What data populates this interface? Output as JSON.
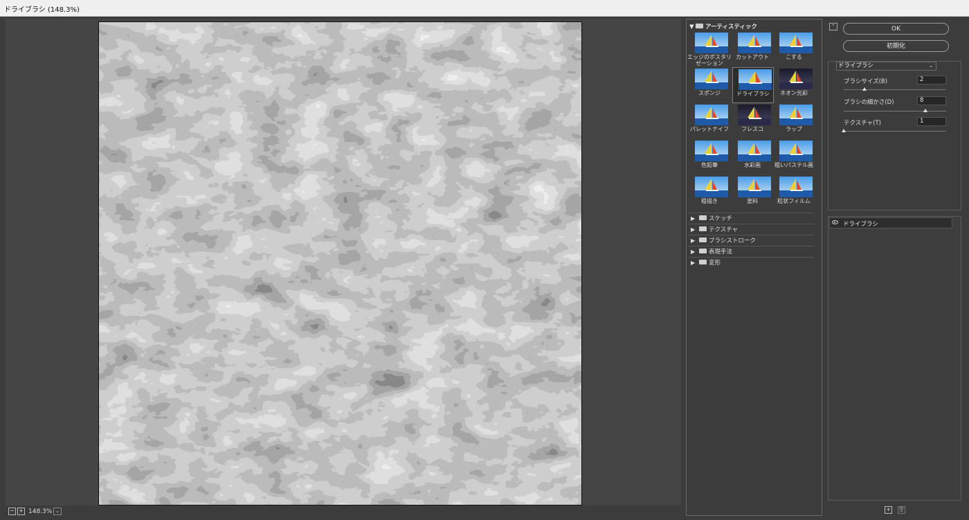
{
  "window": {
    "title": "ドライブラシ (148.3%)"
  },
  "preview": {
    "zoom": "148.3%",
    "zoom_out": "−",
    "zoom_in": "+",
    "zoom_menu": "⌄"
  },
  "gallery": {
    "category_open": "アーティスティック",
    "filters": [
      {
        "label": "エッジのポスタリゼーション",
        "icon": "edge-posterize-thumbnail"
      },
      {
        "label": "カットアウト",
        "icon": "cutout-thumbnail"
      },
      {
        "label": "こする",
        "icon": "smudge-thumbnail"
      },
      {
        "label": "スポンジ",
        "icon": "sponge-thumbnail"
      },
      {
        "label": "ドライブラシ",
        "icon": "dry-brush-thumbnail",
        "selected": true
      },
      {
        "label": "ネオン光彩",
        "icon": "neon-glow-thumbnail"
      },
      {
        "label": "パレットナイフ",
        "icon": "palette-knife-thumbnail"
      },
      {
        "label": "フレスコ",
        "icon": "fresco-thumbnail"
      },
      {
        "label": "ラップ",
        "icon": "plastic-wrap-thumbnail"
      },
      {
        "label": "色鉛筆",
        "icon": "colored-pencil-thumbnail"
      },
      {
        "label": "水彩画",
        "icon": "watercolor-thumbnail"
      },
      {
        "label": "粗いパステル画",
        "icon": "rough-pastels-thumbnail"
      },
      {
        "label": "粗描き",
        "icon": "underpainting-thumbnail"
      },
      {
        "label": "塗料",
        "icon": "paint-daubs-thumbnail"
      },
      {
        "label": "粒状フィルム",
        "icon": "film-grain-thumbnail"
      }
    ],
    "collapsed_categories": [
      "スケッチ",
      "テクスチャ",
      "ブラシストローク",
      "表現手法",
      "変形"
    ]
  },
  "panel": {
    "collapse_icon": "⌃",
    "ok_label": "OK",
    "reset_label": "初期化",
    "filter_select": "ドライブラシ",
    "params": [
      {
        "label": "ブラシサイズ(B)",
        "value": "2",
        "level": 0.2
      },
      {
        "label": "ブラシの細かさ(D)",
        "value": "8",
        "level": 0.8
      },
      {
        "label": "テクスチャ(T)",
        "value": "1",
        "level": 0.0
      }
    ]
  },
  "layers": {
    "items": [
      {
        "label": "ドライブラシ",
        "visible": true
      }
    ],
    "new_layer_icon": "+",
    "delete_layer_icon": "🗑"
  },
  "colors": {
    "accent_sky": "#2f7fd0",
    "sea": "#1f5aa8",
    "sail": "#e8d03a",
    "dark_ui": "#3c3c3c"
  }
}
